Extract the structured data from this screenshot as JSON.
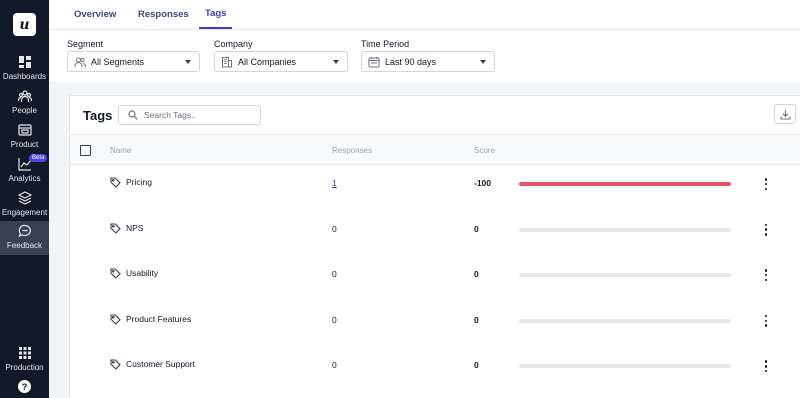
{
  "sidebar": {
    "logo": "u",
    "items": [
      {
        "label": "Dashboards",
        "icon": "dashboard-icon"
      },
      {
        "label": "People",
        "icon": "people-icon"
      },
      {
        "label": "Product",
        "icon": "product-icon"
      },
      {
        "label": "Analytics",
        "icon": "analytics-icon",
        "badge": "Beta"
      },
      {
        "label": "Engagement",
        "icon": "engagement-icon"
      },
      {
        "label": "Feedback",
        "icon": "feedback-icon",
        "active": true
      }
    ],
    "bottom": {
      "label": "Production",
      "icon": "grid-icon"
    },
    "help": "?"
  },
  "tabs": [
    {
      "label": "Overview",
      "active": false
    },
    {
      "label": "Responses",
      "active": false
    },
    {
      "label": "Tags",
      "active": true
    }
  ],
  "filters": {
    "segment": {
      "label": "Segment",
      "value": "All Segments"
    },
    "company": {
      "label": "Company",
      "value": "All Companies"
    },
    "period": {
      "label": "Time Period",
      "value": "Last 90 days"
    }
  },
  "tags_card": {
    "title": "Tags",
    "search_placeholder": "Search Tags..",
    "columns": {
      "name": "Name",
      "responses": "Responses",
      "score": "Score"
    },
    "rows": [
      {
        "name": "Pricing",
        "responses": "1",
        "score": "-100",
        "bar_fraction": 1.0,
        "bar_color": "#e25563",
        "responses_link": true
      },
      {
        "name": "NPS",
        "responses": "0",
        "score": "0",
        "bar_fraction": 0,
        "bar_color": "#e5e7eb",
        "responses_link": false
      },
      {
        "name": "Usability",
        "responses": "0",
        "score": "0",
        "bar_fraction": 0,
        "bar_color": "#e5e7eb",
        "responses_link": false
      },
      {
        "name": "Product Features",
        "responses": "0",
        "score": "0",
        "bar_fraction": 0,
        "bar_color": "#e5e7eb",
        "responses_link": false
      },
      {
        "name": "Customer Support",
        "responses": "0",
        "score": "0",
        "bar_fraction": 0,
        "bar_color": "#e5e7eb",
        "responses_link": false
      }
    ]
  },
  "colors": {
    "accent": "#4338ca",
    "sidebar_bg": "#111827",
    "negative": "#e25563"
  }
}
